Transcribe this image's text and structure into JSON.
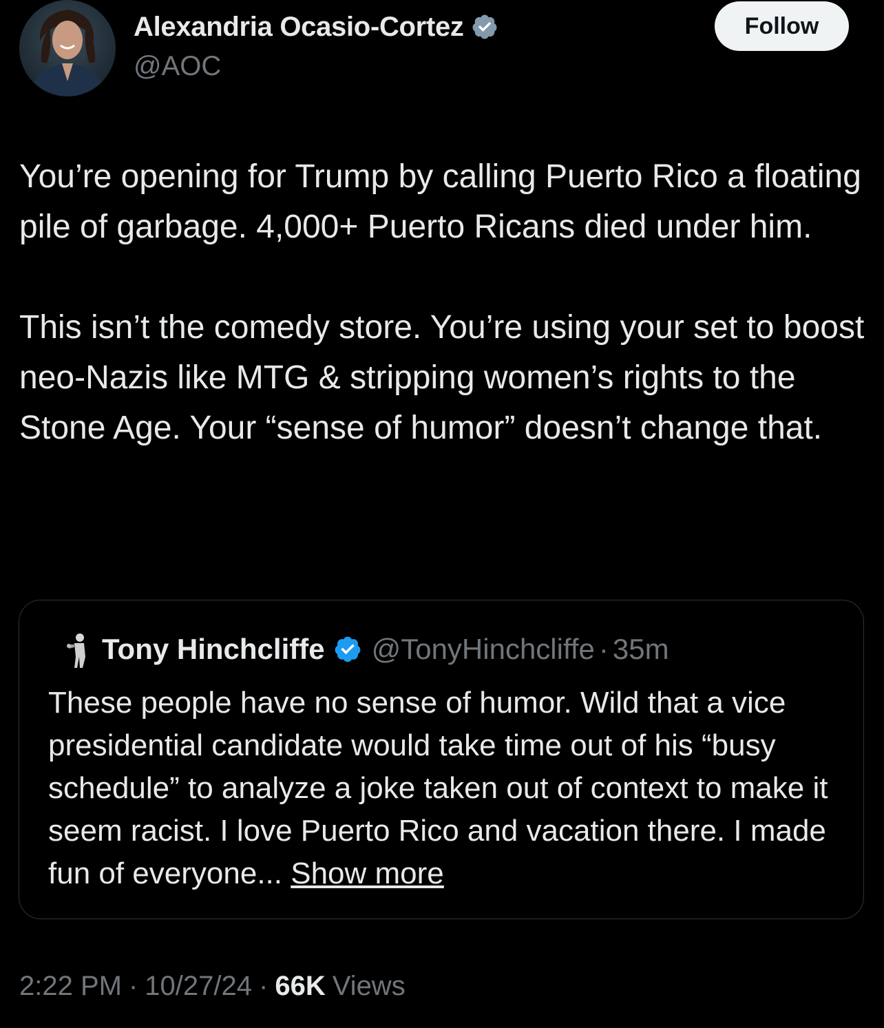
{
  "author": {
    "name": "Alexandria Ocasio-Cortez",
    "handle": "@AOC",
    "verified_badge": "verified-badge-icon",
    "badge_color": "#829aab",
    "avatar": "profile-photo"
  },
  "follow_button": {
    "label": "Follow"
  },
  "tweet": {
    "paragraphs": [
      "You’re opening for Trump by calling Puerto Rico a floating pile of garbage. 4,000+ Puerto Ricans died under him.",
      "This isn’t the comedy store. You’re using your set to boost neo-Nazis like MTG & stripping women’s rights to the Stone Age. Your “sense of humor” doesn’t change that."
    ]
  },
  "quoted_tweet": {
    "author_name": "Tony Hinchcliffe",
    "handle": "@TonyHinchcliffe",
    "separator": "·",
    "time_ago": "35m",
    "verified_badge": "verified-badge-icon",
    "badge_color": "#1d9bf0",
    "text": "These people have no sense of humor. Wild that a vice presidential candidate would take time out of his “busy schedule” to analyze a joke taken out of context to make it seem racist. I love Puerto Rico and vacation there. I made fun of everyone...",
    "show_more_label": "Show more"
  },
  "meta": {
    "time": "2:22 PM",
    "separator": "·",
    "date": "10/27/24",
    "views_count": "66K",
    "views_label": "Views"
  },
  "colors": {
    "background": "#000000",
    "text_primary": "#e7e9ea",
    "text_secondary": "#71767b",
    "border": "#2f3336",
    "follow_bg": "#eff3f4"
  }
}
